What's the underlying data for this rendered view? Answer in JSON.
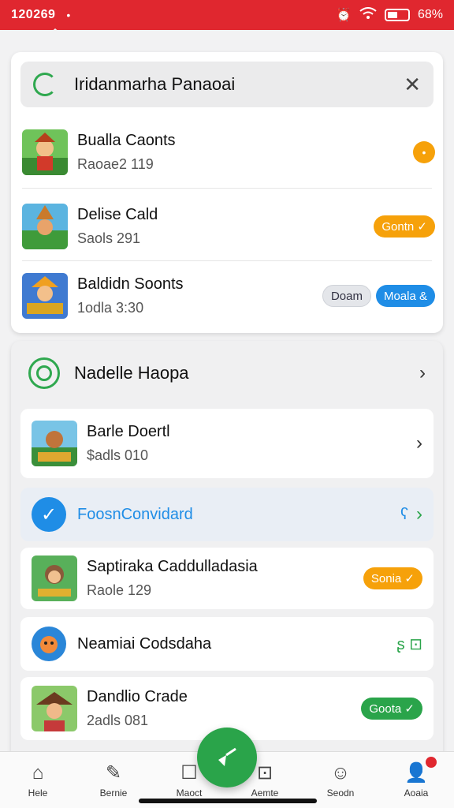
{
  "status": {
    "time": "120269",
    "indicator": "•",
    "battery": "68%",
    "icons": [
      "alarm-icon",
      "wifi-icon",
      "battery-icon"
    ]
  },
  "search": {
    "text": "Iridanmarha Panaoai",
    "close": "✕"
  },
  "card1": {
    "items": [
      {
        "title": "Bualla Caonts",
        "subtitle": "Raoae2 119",
        "badge": "•"
      },
      {
        "title": "Delise Cald",
        "subtitle": "Saols 291",
        "pill": "Gontn ✓"
      },
      {
        "title": "Baldidn Soonts",
        "subtitle": "1odla 3:30",
        "pill_grey": "Doam",
        "pill_blue": "Moala &"
      }
    ]
  },
  "card2": {
    "header": "Nadelle Haopa",
    "items": [
      {
        "title": "Barle Doertl",
        "subtitle": "$adls 010"
      },
      {
        "title": "FoosnConvidard",
        "extra": "ʕ"
      },
      {
        "title": "Saptirakа Caddulladasia",
        "subtitle": "Raole 129",
        "pill": "Sonia ✓"
      },
      {
        "title": "Neamiai Codsdaha",
        "extra": "ʂ ⊡"
      },
      {
        "title": "Dandlio Crade",
        "subtitle": "2adls 081",
        "pill": "Goota ✓"
      }
    ]
  },
  "nav": [
    {
      "label": "Hele",
      "icon": "home-icon"
    },
    {
      "label": "Bernie",
      "icon": "edit-icon"
    },
    {
      "label": "Maoct",
      "icon": "walk-icon"
    },
    {
      "label": "Aemte",
      "icon": "chat-icon"
    },
    {
      "label": "Seodn",
      "icon": "smile-icon"
    },
    {
      "label": "Aoaia",
      "icon": "profile-icon"
    }
  ],
  "colors": {
    "accent": "#e0272f",
    "green": "#2aa44a",
    "blue": "#1f8de6",
    "orange": "#f6a10a"
  }
}
